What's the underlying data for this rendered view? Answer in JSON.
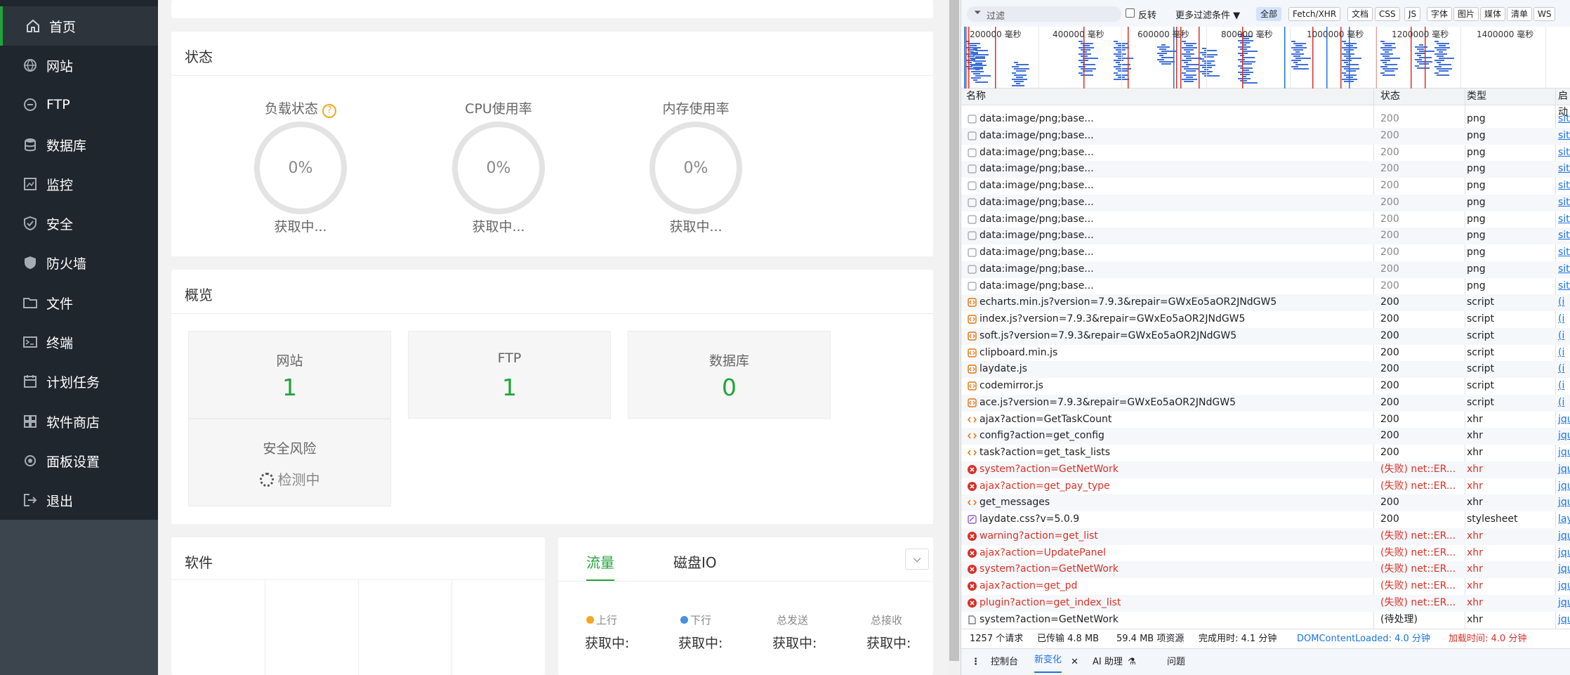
{
  "sidebar": {
    "items": [
      {
        "label": "首页",
        "icon": "home-icon"
      },
      {
        "label": "网站",
        "icon": "globe-icon"
      },
      {
        "label": "FTP",
        "icon": "ftp-icon"
      },
      {
        "label": "数据库",
        "icon": "database-icon"
      },
      {
        "label": "监控",
        "icon": "monitor-icon"
      },
      {
        "label": "安全",
        "icon": "shield-icon"
      },
      {
        "label": "防火墙",
        "icon": "firewall-icon"
      },
      {
        "label": "文件",
        "icon": "folder-icon"
      },
      {
        "label": "终端",
        "icon": "terminal-icon"
      },
      {
        "label": "计划任务",
        "icon": "calendar-icon"
      },
      {
        "label": "软件商店",
        "icon": "apps-icon"
      },
      {
        "label": "面板设置",
        "icon": "settings-icon"
      },
      {
        "label": "退出",
        "icon": "logout-icon"
      }
    ]
  },
  "status": {
    "title": "状态",
    "gauges": [
      {
        "label": "负载状态",
        "value": "0%",
        "sub": "获取中..."
      },
      {
        "label": "CPU使用率",
        "value": "0%",
        "sub": "获取中..."
      },
      {
        "label": "内存使用率",
        "value": "0%",
        "sub": "获取中..."
      }
    ]
  },
  "overview": {
    "title": "概览",
    "boxes": [
      {
        "label": "网站",
        "value": "1"
      },
      {
        "label": "FTP",
        "value": "1"
      },
      {
        "label": "数据库",
        "value": "0"
      }
    ],
    "risk": {
      "label": "安全风险",
      "value": "检测中"
    }
  },
  "software": {
    "title": "软件"
  },
  "traffic": {
    "tabs": [
      "流量",
      "磁盘IO"
    ],
    "cols": [
      {
        "label": "上行",
        "value": "获取中:",
        "dot": "#f5a623"
      },
      {
        "label": "下行",
        "value": "获取中:",
        "dot": "#4a90e2"
      },
      {
        "label": "总发送",
        "value": "获取中:"
      },
      {
        "label": "总接收",
        "value": "获取中:"
      }
    ]
  },
  "devtools": {
    "filter_placeholder": "过滤",
    "invert_label": "反转",
    "more_filters": "更多过滤条件 ▼",
    "chips": [
      "全部",
      "Fetch/XHR",
      "文档",
      "CSS",
      "JS",
      "字体",
      "图片",
      "媒体",
      "清单",
      "WS"
    ],
    "timeline_labels": [
      "200000 毫秒",
      "400000 毫秒",
      "600000 毫秒",
      "800000 毫秒",
      "1000000 毫秒",
      "1200000 毫秒",
      "1400000 毫秒"
    ],
    "headers": {
      "name": "名称",
      "status": "状态",
      "type": "类型",
      "init": "启动"
    },
    "rows": [
      {
        "name": "data:image/png;base...",
        "status": "200",
        "type": "png",
        "init": "site",
        "kind": "img",
        "err": false
      },
      {
        "name": "data:image/png;base...",
        "status": "200",
        "type": "png",
        "init": "site",
        "kind": "img",
        "err": false
      },
      {
        "name": "data:image/png;base...",
        "status": "200",
        "type": "png",
        "init": "site",
        "kind": "img",
        "err": false
      },
      {
        "name": "data:image/png;base...",
        "status": "200",
        "type": "png",
        "init": "site",
        "kind": "img",
        "err": false
      },
      {
        "name": "data:image/png;base...",
        "status": "200",
        "type": "png",
        "init": "site",
        "kind": "img",
        "err": false
      },
      {
        "name": "data:image/png;base...",
        "status": "200",
        "type": "png",
        "init": "site",
        "kind": "img",
        "err": false
      },
      {
        "name": "data:image/png;base...",
        "status": "200",
        "type": "png",
        "init": "site",
        "kind": "img",
        "err": false
      },
      {
        "name": "data:image/png;base...",
        "status": "200",
        "type": "png",
        "init": "site",
        "kind": "img",
        "err": false
      },
      {
        "name": "data:image/png;base...",
        "status": "200",
        "type": "png",
        "init": "site",
        "kind": "img",
        "err": false
      },
      {
        "name": "data:image/png;base...",
        "status": "200",
        "type": "png",
        "init": "site",
        "kind": "img",
        "err": false
      },
      {
        "name": "data:image/png;base...",
        "status": "200",
        "type": "png",
        "init": "site",
        "kind": "img",
        "err": false
      },
      {
        "name": "echarts.min.js?version=7.9.3&repair=GWxEo5aOR2JNdGW5",
        "status": "200",
        "type": "script",
        "init": "(i",
        "kind": "script",
        "err": false
      },
      {
        "name": "index.js?version=7.9.3&repair=GWxEo5aOR2JNdGW5",
        "status": "200",
        "type": "script",
        "init": "(i",
        "kind": "script",
        "err": false
      },
      {
        "name": "soft.js?version=7.9.3&repair=GWxEo5aOR2JNdGW5",
        "status": "200",
        "type": "script",
        "init": "(i",
        "kind": "script",
        "err": false
      },
      {
        "name": "clipboard.min.js",
        "status": "200",
        "type": "script",
        "init": "(i",
        "kind": "script",
        "err": false
      },
      {
        "name": "laydate.js",
        "status": "200",
        "type": "script",
        "init": "(i",
        "kind": "script",
        "err": false
      },
      {
        "name": "codemirror.js",
        "status": "200",
        "type": "script",
        "init": "(i",
        "kind": "script",
        "err": false
      },
      {
        "name": "ace.js?version=7.9.3&repair=GWxEo5aOR2JNdGW5",
        "status": "200",
        "type": "script",
        "init": "(i",
        "kind": "script",
        "err": false
      },
      {
        "name": "ajax?action=GetTaskCount",
        "status": "200",
        "type": "xhr",
        "init": "jqu",
        "kind": "xhr",
        "err": false
      },
      {
        "name": "config?action=get_config",
        "status": "200",
        "type": "xhr",
        "init": "jqu",
        "kind": "xhr",
        "err": false
      },
      {
        "name": "task?action=get_task_lists",
        "status": "200",
        "type": "xhr",
        "init": "jqu",
        "kind": "xhr",
        "err": false
      },
      {
        "name": "system?action=GetNetWork",
        "status": "(失败)  net::ER...",
        "type": "xhr",
        "init": "jqu",
        "kind": "err",
        "err": true
      },
      {
        "name": "ajax?action=get_pay_type",
        "status": "(失败)  net::ER...",
        "type": "xhr",
        "init": "jqu",
        "kind": "err",
        "err": true
      },
      {
        "name": "get_messages",
        "status": "200",
        "type": "xhr",
        "init": "jqu",
        "kind": "xhr",
        "err": false
      },
      {
        "name": "laydate.css?v=5.0.9",
        "status": "200",
        "type": "stylesheet",
        "init": "lay",
        "kind": "css",
        "err": false
      },
      {
        "name": "warning?action=get_list",
        "status": "(失败)  net::ER...",
        "type": "xhr",
        "init": "jqu",
        "kind": "err",
        "err": true
      },
      {
        "name": "ajax?action=UpdatePanel",
        "status": "(失败)  net::ER...",
        "type": "xhr",
        "init": "jqu",
        "kind": "err",
        "err": true
      },
      {
        "name": "system?action=GetNetWork",
        "status": "(失败)  net::ER...",
        "type": "xhr",
        "init": "jqu",
        "kind": "err",
        "err": true
      },
      {
        "name": "ajax?action=get_pd",
        "status": "(失败)  net::ER...",
        "type": "xhr",
        "init": "jqu",
        "kind": "err",
        "err": true
      },
      {
        "name": "plugin?action=get_index_list",
        "status": "(失败)  net::ER...",
        "type": "xhr",
        "init": "jqu",
        "kind": "err",
        "err": true
      },
      {
        "name": "system?action=GetNetWork",
        "status": "(待处理)",
        "type": "xhr",
        "init": "jqu",
        "kind": "doc",
        "err": false
      }
    ],
    "summary": {
      "requests": "1257 个请求",
      "transferred": "已传输 4.8 MB",
      "resources": "59.4 MB 项资源",
      "finish": "完成用时: 4.1 分钟",
      "domcontent": "DOMContentLoaded: 4.0 分钟",
      "load": "加载时间: 4.0 分钟"
    },
    "drawer_tabs": [
      "控制台",
      "新变化",
      "AI 助理",
      "问题"
    ],
    "colors": {
      "error": "#d93025",
      "link": "#1a73e8",
      "green": "#20a53a"
    }
  }
}
